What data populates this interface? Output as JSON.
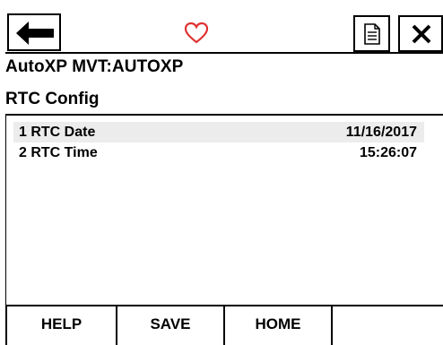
{
  "toolbar": {
    "back_icon": "arrow-left-icon",
    "heart_icon": "heart-icon",
    "heart_color": "#e03030",
    "document_icon": "document-icon",
    "close_icon": "close-icon"
  },
  "header": {
    "device_title": "AutoXP MVT:AUTOXP",
    "page_title": "RTC Config"
  },
  "list": {
    "items": [
      {
        "label": "1 RTC Date",
        "value": "11/16/2017",
        "selected": true
      },
      {
        "label": "2 RTC Time",
        "value": "15:26:07",
        "selected": false
      }
    ]
  },
  "softkeys": {
    "help": "HELP",
    "save": "SAVE",
    "home": "HOME",
    "empty": ""
  }
}
